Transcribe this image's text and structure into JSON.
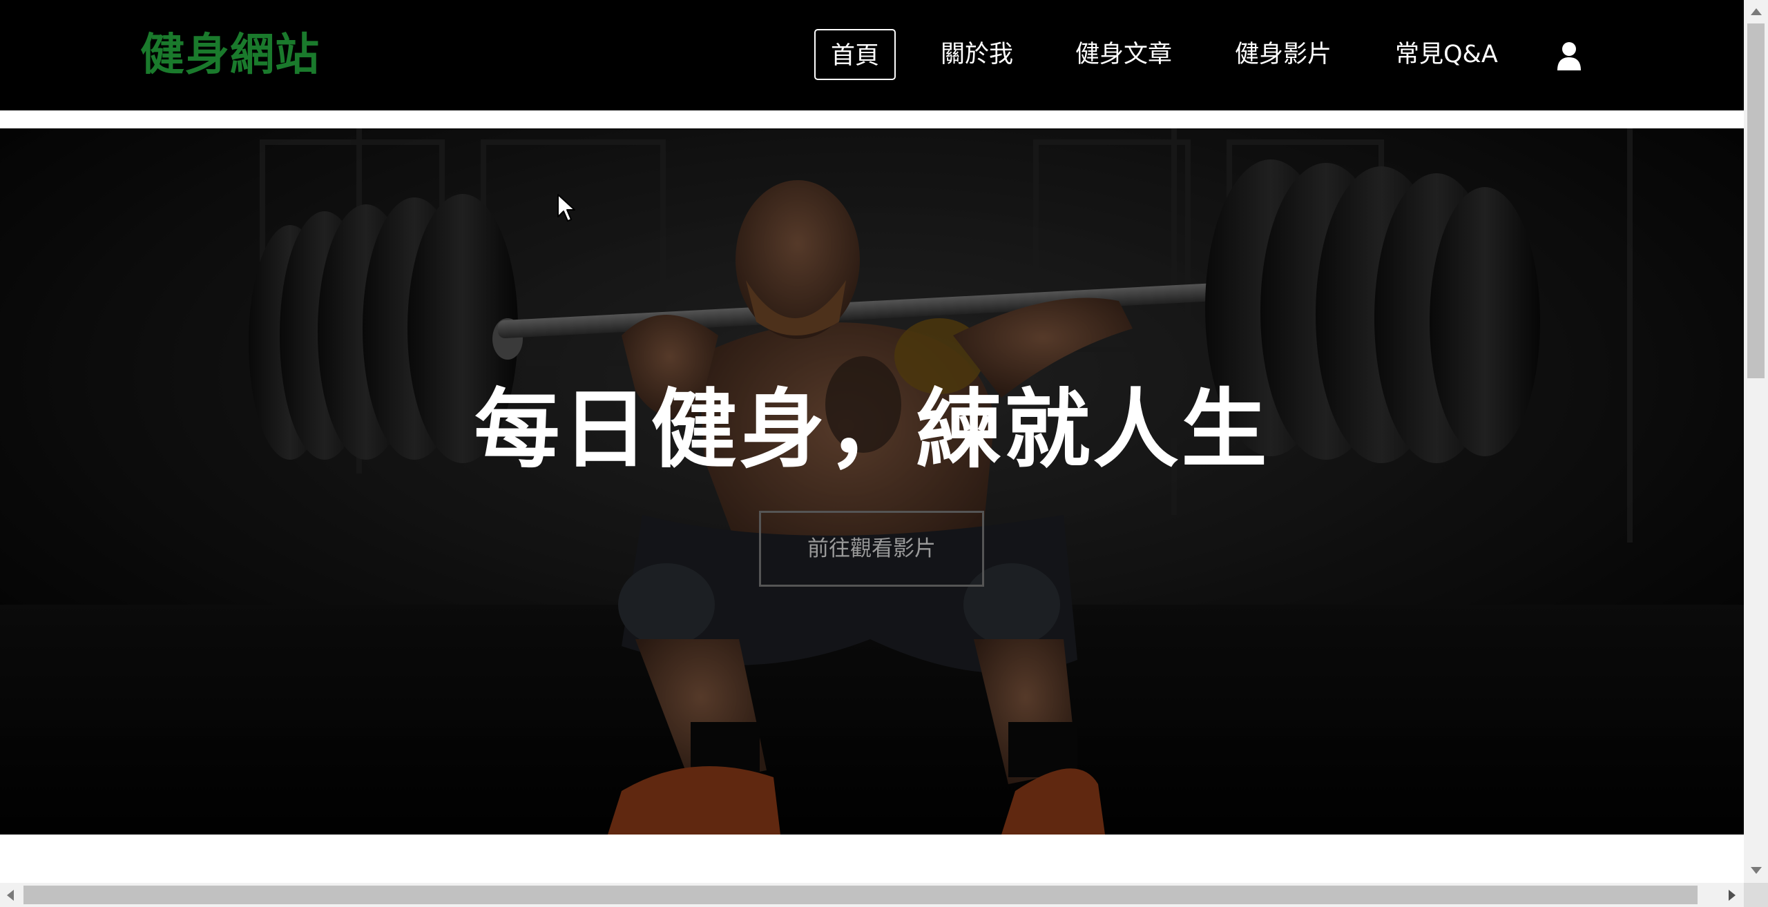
{
  "brand": {
    "name": "健身網站",
    "color": "#1a7a2c"
  },
  "nav": {
    "home": "首頁",
    "about": "關於我",
    "articles": "健身文章",
    "videos": "健身影片",
    "faq": "常見Q&A",
    "account_icon": "user-icon"
  },
  "hero": {
    "title": "每日健身，練就人生",
    "button_label": "前往觀看影片",
    "image": "dark gym photo, man squatting with loaded barbell"
  },
  "colors": {
    "nav_background": "#000000",
    "hero_overlay": "#000000"
  }
}
